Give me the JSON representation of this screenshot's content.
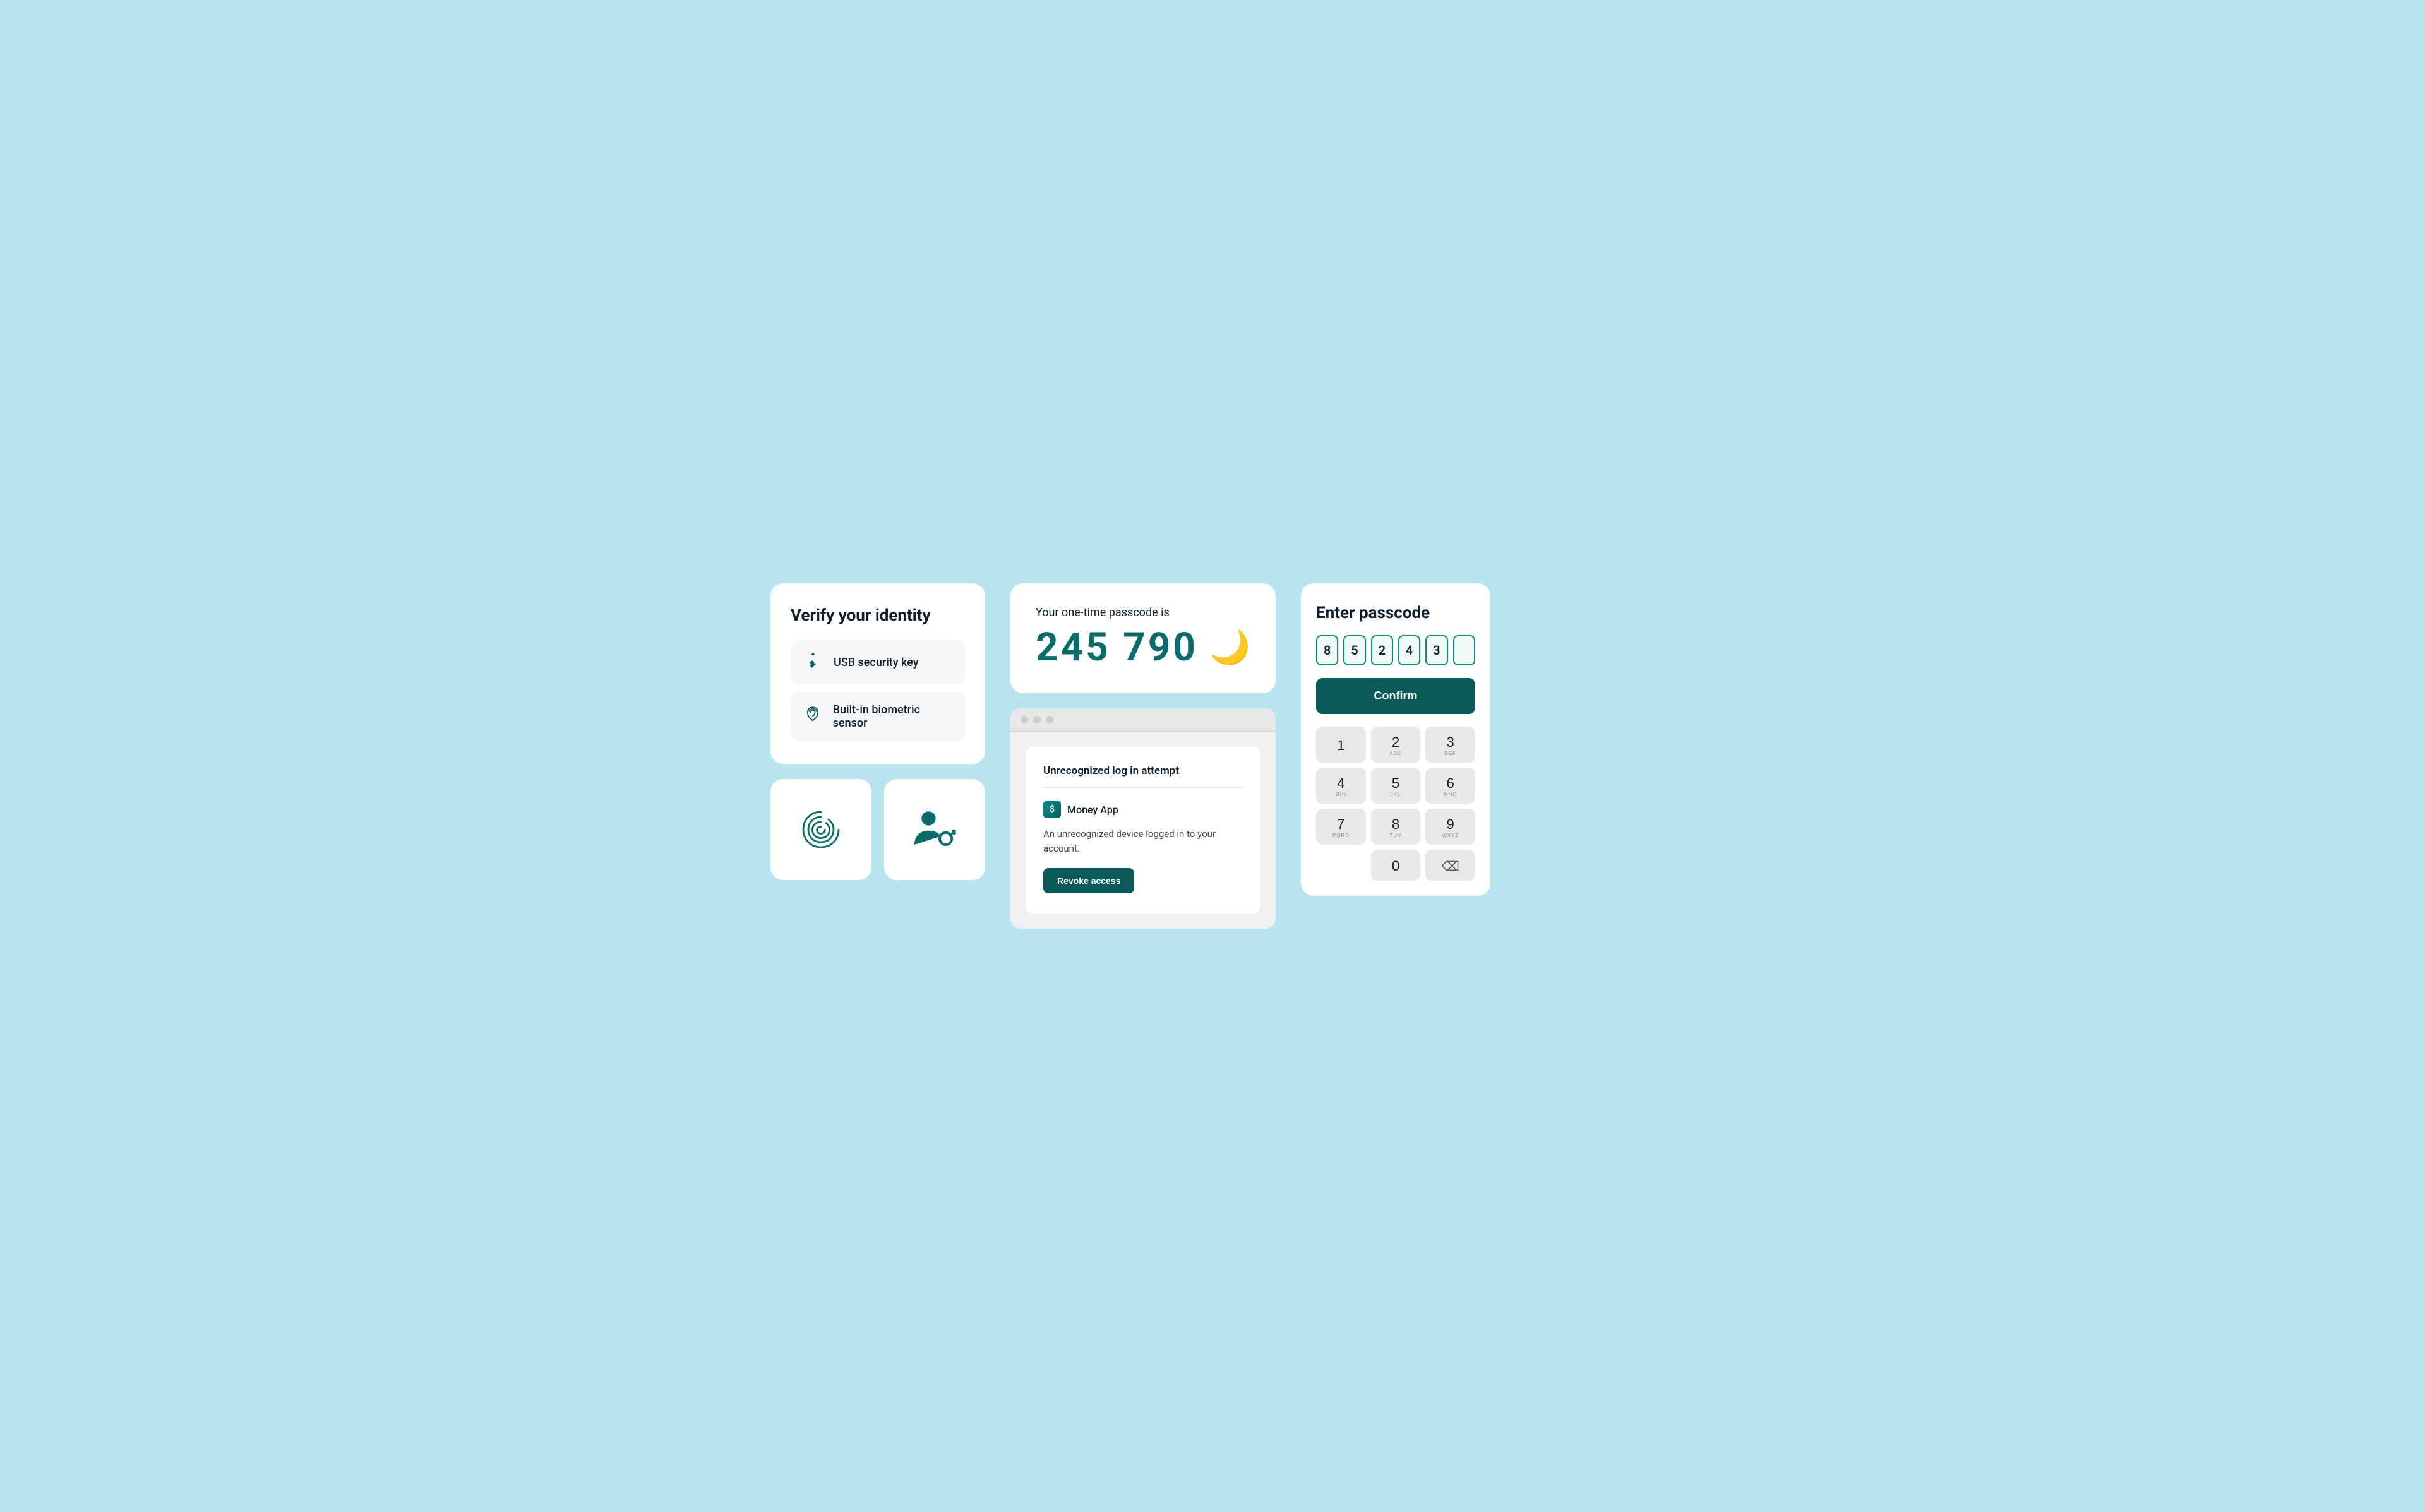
{
  "background_color": "#b8e4f0",
  "left": {
    "verify_title": "Verify your identity",
    "options": [
      {
        "id": "usb",
        "icon": "⌁",
        "label": "USB security key"
      },
      {
        "id": "biometric",
        "icon": "◎",
        "label": "Built-in biometric sensor"
      }
    ]
  },
  "middle": {
    "passcode_subtitle": "Your one-time passcode is",
    "passcode_value": "245  790",
    "browser": {
      "title": "Unrecognized log in attempt",
      "app_name": "Money App",
      "description": "An unrecognized device logged in to your account.",
      "revoke_label": "Revoke access"
    }
  },
  "right": {
    "title": "Enter passcode",
    "digits": [
      "8",
      "5",
      "2",
      "4",
      "3",
      ""
    ],
    "confirm_label": "Confirm",
    "numpad": [
      {
        "main": "1",
        "sub": ""
      },
      {
        "main": "2",
        "sub": "ABC"
      },
      {
        "main": "3",
        "sub": "DEF"
      },
      {
        "main": "4",
        "sub": "GHI"
      },
      {
        "main": "5",
        "sub": "JKL"
      },
      {
        "main": "6",
        "sub": "MNO"
      },
      {
        "main": "7",
        "sub": "PQRS"
      },
      {
        "main": "8",
        "sub": "TUV"
      },
      {
        "main": "9",
        "sub": "WXYZ"
      },
      {
        "main": "0",
        "sub": ""
      }
    ]
  }
}
